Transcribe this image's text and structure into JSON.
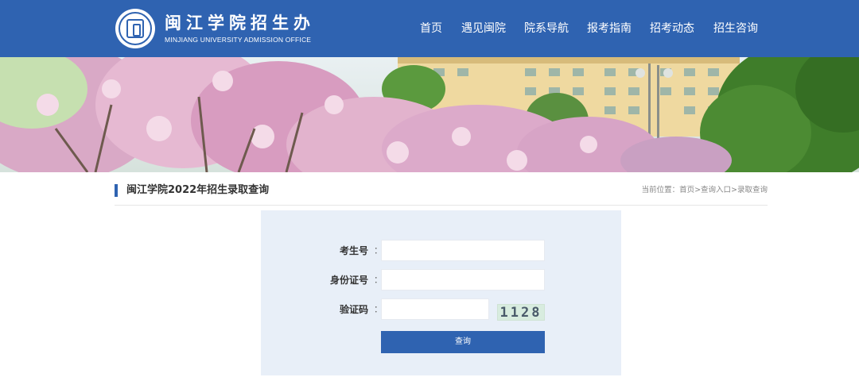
{
  "header": {
    "logo_cn": "闽江学院招生办",
    "logo_en": "MINJIANG UNIVERSITY ADMISSION OFFICE",
    "nav": [
      {
        "label": "首页"
      },
      {
        "label": "遇见闽院"
      },
      {
        "label": "院系导航"
      },
      {
        "label": "报考指南"
      },
      {
        "label": "招考动态"
      },
      {
        "label": "招生咨询"
      }
    ],
    "colors": {
      "bar": "#2f63b1"
    }
  },
  "banner": {
    "icon": "campus-photo-banner"
  },
  "page": {
    "title": "闽江学院2022年招生录取查询",
    "breadcrumb": "当前位置：首页>查询入口>录取查询"
  },
  "form": {
    "fields": [
      {
        "label": "考生号",
        "colon": "：",
        "value": ""
      },
      {
        "label": "身份证号",
        "colon": "：",
        "value": ""
      },
      {
        "label": "验证码",
        "colon": "：",
        "value": ""
      }
    ],
    "captcha": "1128",
    "submit_label": "查询",
    "colors": {
      "panel": "#e8eff8",
      "button": "#2f63b1"
    }
  }
}
